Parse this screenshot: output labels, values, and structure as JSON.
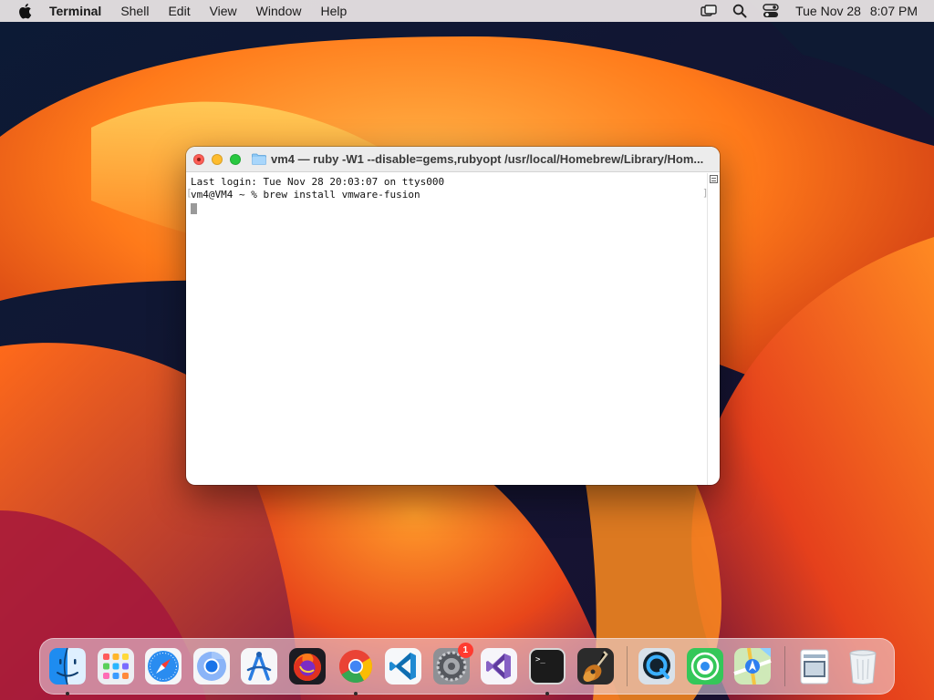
{
  "menubar": {
    "app_name": "Terminal",
    "menus": [
      "Shell",
      "Edit",
      "View",
      "Window",
      "Help"
    ],
    "status_icons": [
      "screen-mirroring-icon",
      "search-icon",
      "control-center-icon"
    ],
    "date": "Tue Nov 28",
    "time": "8:07 PM"
  },
  "window": {
    "title": "vm4 — ruby -W1 --disable=gems,rubyopt /usr/local/Homebrew/Library/Hom...",
    "lines": [
      "Last login: Tue Nov 28 20:03:07 on ttys000",
      "vm4@VM4 ~ % brew install vmware-fusion"
    ]
  },
  "dock": {
    "apps": [
      {
        "name": "Finder",
        "icon": "finder-icon",
        "running": true
      },
      {
        "name": "Launchpad",
        "icon": "launchpad-icon",
        "running": false
      },
      {
        "name": "Safari",
        "icon": "safari-icon",
        "running": false
      },
      {
        "name": "Chromium",
        "icon": "chromium-icon",
        "running": false
      },
      {
        "name": "Xcode Instruments",
        "icon": "instruments-icon",
        "running": false
      },
      {
        "name": "Firefox",
        "icon": "firefox-icon",
        "running": false
      },
      {
        "name": "Google Chrome",
        "icon": "chrome-icon",
        "running": true
      },
      {
        "name": "Visual Studio Code",
        "icon": "vscode-icon",
        "running": false
      },
      {
        "name": "System Preferences",
        "icon": "system-preferences-icon",
        "running": false,
        "badge": "1"
      },
      {
        "name": "Visual Studio",
        "icon": "visual-studio-icon",
        "running": false
      },
      {
        "name": "Terminal",
        "icon": "terminal-icon",
        "running": true
      },
      {
        "name": "GarageBand",
        "icon": "garageband-icon",
        "running": false
      },
      {
        "name": "QuickTime Player",
        "icon": "quicktime-icon",
        "running": false
      },
      {
        "name": "Find My",
        "icon": "find-my-icon",
        "running": false
      },
      {
        "name": "Maps",
        "icon": "maps-icon",
        "running": false
      },
      {
        "name": "Preview",
        "icon": "preview-icon",
        "running": false
      },
      {
        "name": "Trash",
        "icon": "trash-icon",
        "running": false
      }
    ]
  }
}
